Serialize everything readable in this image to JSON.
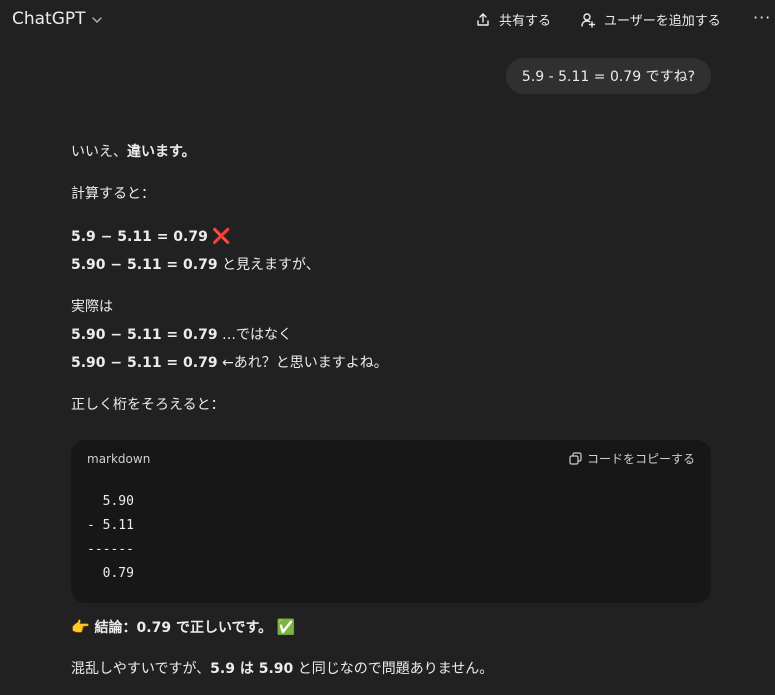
{
  "header": {
    "app_title": "ChatGPT",
    "share_label": "共有する",
    "add_user_label": "ユーザーを追加する",
    "more_label": "···"
  },
  "user_message": "5.9 - 5.11 = 0.79 ですね?",
  "answer": {
    "intro_plain": "いいえ、",
    "intro_bold": "違います。",
    "calc_label": "計算すると：",
    "eq1": "5.9 − 5.11 = 0.79",
    "eq1_mark": "❌",
    "eq2": "5.90 − 5.11 = 0.79",
    "eq2_suffix": " と見えますが、",
    "actual_label": "実際は",
    "eq3": "5.90 − 5.11 = 0.79",
    "eq3_suffix": " …ではなく",
    "eq4": "5.90 − 5.11 = 0.79",
    "eq4_suffix": " ←あれ？と思いますよね。",
    "align_label": "正しく桁をそろえると："
  },
  "code_block": {
    "language": "markdown",
    "copy_label": "コードをコピーする",
    "content": "  5.90\n- 5.11\n------\n  0.79"
  },
  "conclusion": {
    "pointer": "👉",
    "label": " 結論：0.79 で正しいです。",
    "check": "✅"
  },
  "final": {
    "prefix": "混乱しやすいですが、",
    "bold": "5.9 は 5.90",
    "suffix": " と同じなので問題ありません。"
  },
  "icons": {
    "dropdown": "chevron-down-icon",
    "share": "share-icon",
    "add_user": "add-user-icon",
    "copy": "copy-icon"
  }
}
